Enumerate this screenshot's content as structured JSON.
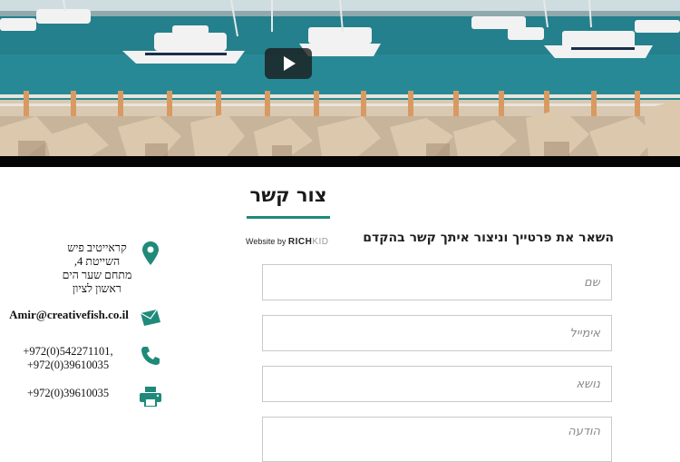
{
  "hero": {
    "play_label": "Play video"
  },
  "contact": {
    "title": "צור קשר",
    "intro": "השאר את פרטייך וניצור איתך קשר בהקדם",
    "credit_prefix": "Website by",
    "credit_brand": "RICH",
    "credit_brand_suffix": "KID"
  },
  "form": {
    "name_placeholder": "שם",
    "email_placeholder": "אימייל",
    "subject_placeholder": "נושא",
    "message_placeholder": "הודעה"
  },
  "info": {
    "address_line1": "קראייטיב פיש",
    "address_line2": "השייטת 4,",
    "address_line3": "מתחם שער הים",
    "address_line4": "ראשון לציון",
    "email": "Amir@creativefish.co.il",
    "phone_line1": "+972(0)542271101,",
    "phone_line2": "+972(0)39610035",
    "fax": "+972(0)39610035"
  },
  "colors": {
    "accent": "#1f8a7a",
    "icon": "#1f8a7a",
    "text": "#111111"
  },
  "icons": [
    "play-icon",
    "location-pin-icon",
    "envelope-icon",
    "phone-icon",
    "printer-icon"
  ]
}
